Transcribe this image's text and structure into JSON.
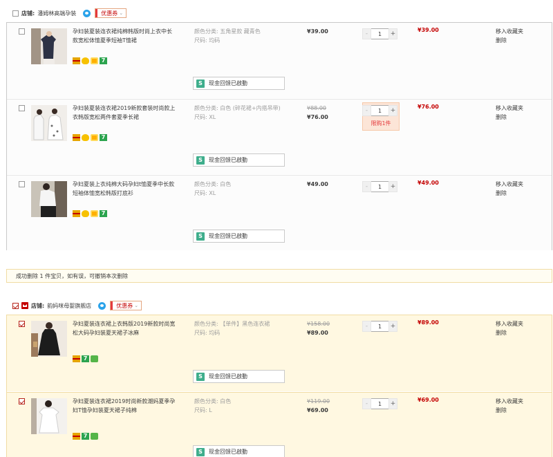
{
  "colors": {
    "price_red": "#c40000",
    "selected_bg": "#fff8e1",
    "rebate_green": "#3fae8c"
  },
  "shops": [
    {
      "label": "店铺:",
      "name": "潘姆林高端孕装",
      "coupon": "优惠券",
      "items": [
        {
          "title": "孕妇装夏装连衣裙纯棉韩版时尚上衣中长款宽松体恤夏季短袖T恤裙",
          "spec_color": "颜色分类: 五角星款 藏青色",
          "spec_size": "尺码: 均码",
          "orig_price": "",
          "price": "¥39.00",
          "qty": "1",
          "limit": "",
          "subtotal": "¥39.00",
          "op_fav": "移入收藏夹",
          "op_del": "删除",
          "rebate": "现金回馈已啟動",
          "rebate_icon": "S",
          "tags": [
            "card-icon",
            "flower-icon",
            "sun-icon",
            "seven-icon"
          ]
        },
        {
          "title": "孕妇装夏装连衣裙2019新款套装时尚款上衣韩版宽松两件套夏季长裙",
          "spec_color": "颜色分类: 白色 (碎花裙+内搭吊带)",
          "spec_size": "尺码: XL",
          "orig_price": "¥88.00",
          "price": "¥76.00",
          "qty": "1",
          "limit": "限购1件",
          "subtotal": "¥76.00",
          "op_fav": "移入收藏夹",
          "op_del": "删除",
          "rebate": "现金回馈已啟動",
          "rebate_icon": "S",
          "tags": [
            "card-icon",
            "flower-icon",
            "sun-icon",
            "seven-icon"
          ]
        },
        {
          "title": "孕妇夏装上衣纯棉大码孕妇t恤夏季中长款短袖体恤宽松韩版打底衫",
          "spec_color": "颜色分类: 白色",
          "spec_size": "尺码: XL",
          "orig_price": "",
          "price": "¥49.00",
          "qty": "1",
          "limit": "",
          "subtotal": "¥49.00",
          "op_fav": "移入收藏夹",
          "op_del": "删除",
          "rebate": "现金回馈已啟動",
          "rebate_icon": "S",
          "tags": [
            "card-icon",
            "flower-icon",
            "sun-icon",
            "seven-icon"
          ]
        }
      ]
    },
    {
      "label": "店铺:",
      "name": "韵妈咪母婴旗舰店",
      "coupon": "优惠券",
      "items": [
        {
          "title": "孕妇夏装连衣裙上衣韩版2019新款时尚宽松大码孕妇装夏天裙子冰麻",
          "spec_color": "颜色分类: 【单件】黑色连衣裙",
          "spec_size": "尺码: 均码",
          "orig_price": "¥158.00",
          "price": "¥89.00",
          "qty": "1",
          "limit": "",
          "subtotal": "¥89.00",
          "op_fav": "移入收藏夹",
          "op_del": "删除",
          "rebate": "现金回馈已啟動",
          "rebate_icon": "S",
          "tags": [
            "card-icon",
            "seven-icon",
            "leaf-icon"
          ]
        },
        {
          "title": "孕妇夏装连衣裙2019时尚新款潮妈夏季孕妇T恤孕妇装夏天裙子纯棉",
          "spec_color": "颜色分类: 白色",
          "spec_size": "尺码: L",
          "orig_price": "¥119.00",
          "price": "¥69.00",
          "qty": "1",
          "limit": "",
          "subtotal": "¥69.00",
          "op_fav": "移入收藏夹",
          "op_del": "删除",
          "rebate": "现金回馈已啟動",
          "rebate_icon": "S",
          "tags": [
            "card-icon",
            "seven-icon",
            "leaf-icon"
          ]
        }
      ]
    }
  ],
  "notice": "成功删除 1 件宝贝，如有误，可撤销本次删除",
  "qty_controls": {
    "minus": "-",
    "plus": "+"
  }
}
